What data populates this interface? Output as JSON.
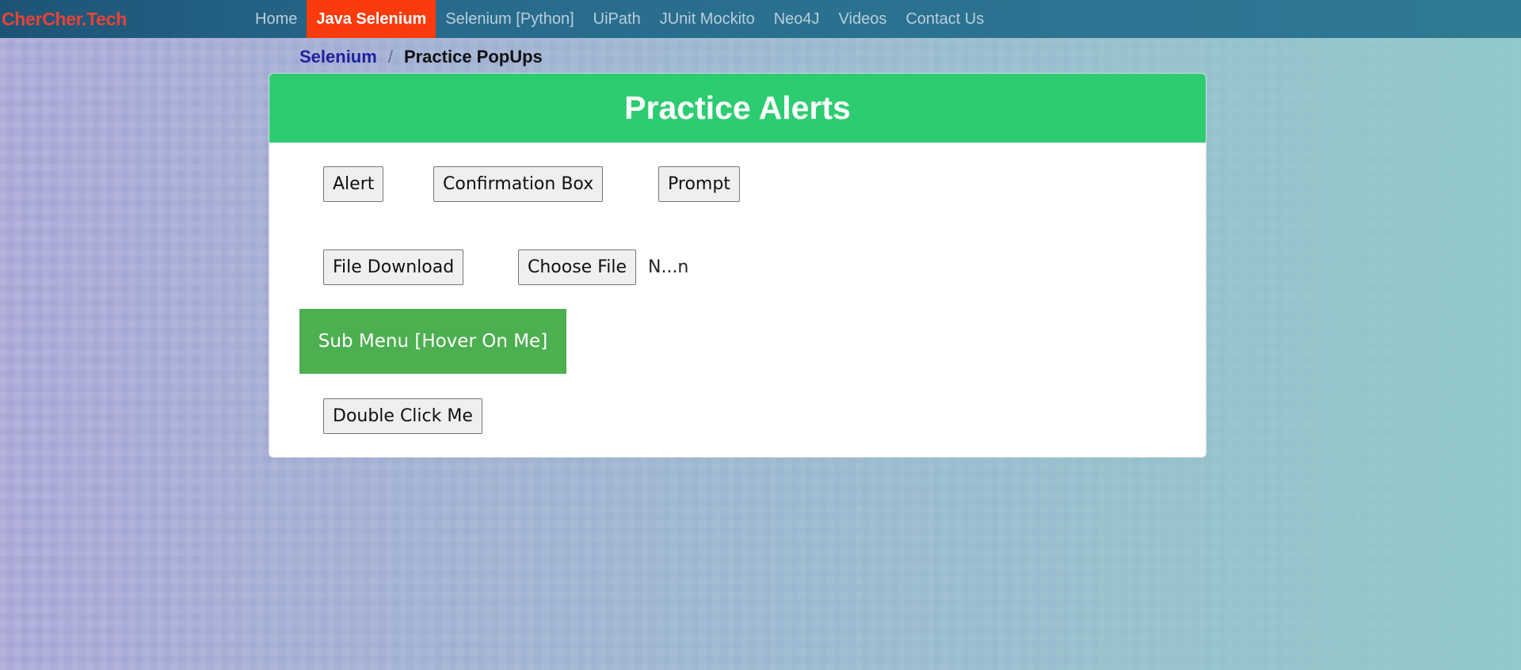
{
  "nav": {
    "brand": "CherCher.Tech",
    "items": [
      {
        "label": "Home",
        "active": false
      },
      {
        "label": "Java Selenium",
        "active": true
      },
      {
        "label": "Selenium [Python]",
        "active": false
      },
      {
        "label": "UiPath",
        "active": false
      },
      {
        "label": "JUnit Mockito",
        "active": false
      },
      {
        "label": "Neo4J",
        "active": false
      },
      {
        "label": "Videos",
        "active": false
      },
      {
        "label": "Contact Us",
        "active": false
      }
    ]
  },
  "breadcrumb": {
    "parent": "Selenium",
    "separator": "/",
    "current": "Practice PopUps"
  },
  "card": {
    "title": "Practice Alerts",
    "buttons": {
      "alert": "Alert",
      "confirmation": "Confirmation Box",
      "prompt": "Prompt",
      "file_download": "File Download",
      "choose_file": "Choose File",
      "double_click": "Double Click Me"
    },
    "file_status": "N...n",
    "submenu": "Sub Menu [Hover On Me]"
  },
  "colors": {
    "nav_bg": "#286b8c",
    "brand": "#ea4335",
    "active_tab": "#fb3b0c",
    "card_header": "#2ecc71",
    "submenu": "#4caf50"
  }
}
